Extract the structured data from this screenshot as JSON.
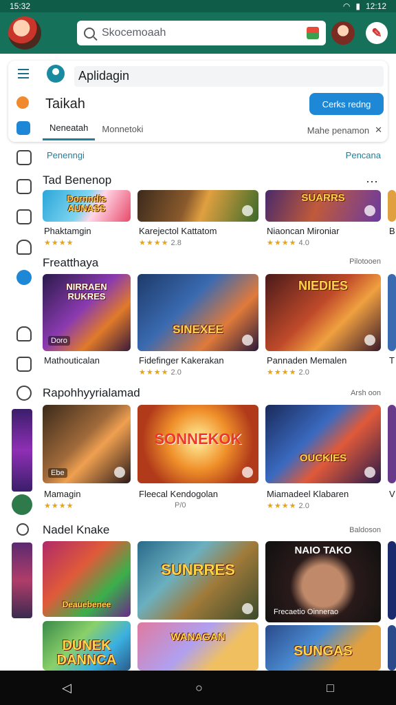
{
  "status": {
    "time": "15:32",
    "right": "12:12"
  },
  "search": {
    "placeholder": "Skocemoaah"
  },
  "header": {
    "app_name": "Aplidagin",
    "title": "Taikah",
    "cta": "Cerks redng"
  },
  "tabs": {
    "active": "Neneatah",
    "second": "Monnetoki",
    "right": "Mahe penamon",
    "close": "✕"
  },
  "subheader": {
    "left": "Penenngi",
    "right": "Pencana"
  },
  "sections": [
    {
      "title": "Tad Benenop",
      "link": "⋯",
      "items": [
        {
          "art_title": "Dornndis AUNASS",
          "name": "Phaktamgin",
          "stars": "★★★★",
          "meta": ""
        },
        {
          "art_title": "",
          "name": "Karejectol Kattatom",
          "stars": "★★★★",
          "meta": "2.8"
        },
        {
          "art_title": "SUARRS",
          "name": "Niaoncan Mironiar",
          "stars": "★★★★",
          "meta": "4.0"
        },
        {
          "art_title": "",
          "name": "B",
          "stars": "",
          "meta": ""
        }
      ]
    },
    {
      "title": "Freatthaya",
      "link": "Pilotooen",
      "items": [
        {
          "art_title": "NIRRAEN RUKRES",
          "art_small": "Doro",
          "name": "Mathouticalan",
          "stars": "",
          "meta": ""
        },
        {
          "art_title": "SINEXEE",
          "name": "Fidefinger Kakerakan",
          "stars": "★★★★",
          "meta": "2.0"
        },
        {
          "art_title": "NIEDIES",
          "name": "Pannaden Memalen",
          "stars": "★★★★",
          "meta": "2.0"
        },
        {
          "art_title": "",
          "name": "T",
          "stars": "",
          "meta": ""
        }
      ]
    },
    {
      "title": "Rapohhyyrialamad",
      "link": "Arsh oon",
      "items": [
        {
          "art_title": "",
          "art_small": "Ebe",
          "name": "Mamagin",
          "stars": "★★★★",
          "meta": ""
        },
        {
          "art_title": "SONNEKOK",
          "name": "Fleecal Kendogolan",
          "stars": "",
          "meta": "P/0"
        },
        {
          "art_title": "OUCKIES",
          "name": "Miamadeel Klabaren",
          "stars": "★★★★",
          "meta": "2.0"
        },
        {
          "art_title": "",
          "name": "V",
          "stars": "",
          "meta": ""
        }
      ]
    },
    {
      "title": "Nadel Knake",
      "link": "Baldoson",
      "items": [
        {
          "art_title": "Deauebenee",
          "name": "",
          "stars": "",
          "meta": ""
        },
        {
          "art_title": "SUNRRES",
          "name": "",
          "stars": "",
          "meta": ""
        },
        {
          "art_title": "NAIO TAKO",
          "art_small": "Frecaetio Oinnerao",
          "name": "",
          "stars": "",
          "meta": ""
        },
        {
          "art_title": "DUNEK DANNCA",
          "name": "",
          "stars": "",
          "meta": ""
        },
        {
          "art_title": "WANAGAN",
          "name": "",
          "stars": "",
          "meta": ""
        },
        {
          "art_title": "SUNGAS",
          "name": "",
          "stars": "",
          "meta": ""
        }
      ]
    }
  ],
  "nav": {
    "back": "◁",
    "home": "○",
    "recent": "□"
  },
  "colors": {
    "brand": "#15715a",
    "accent": "#1e88d6",
    "tab_indicator": "#1d7f99"
  }
}
